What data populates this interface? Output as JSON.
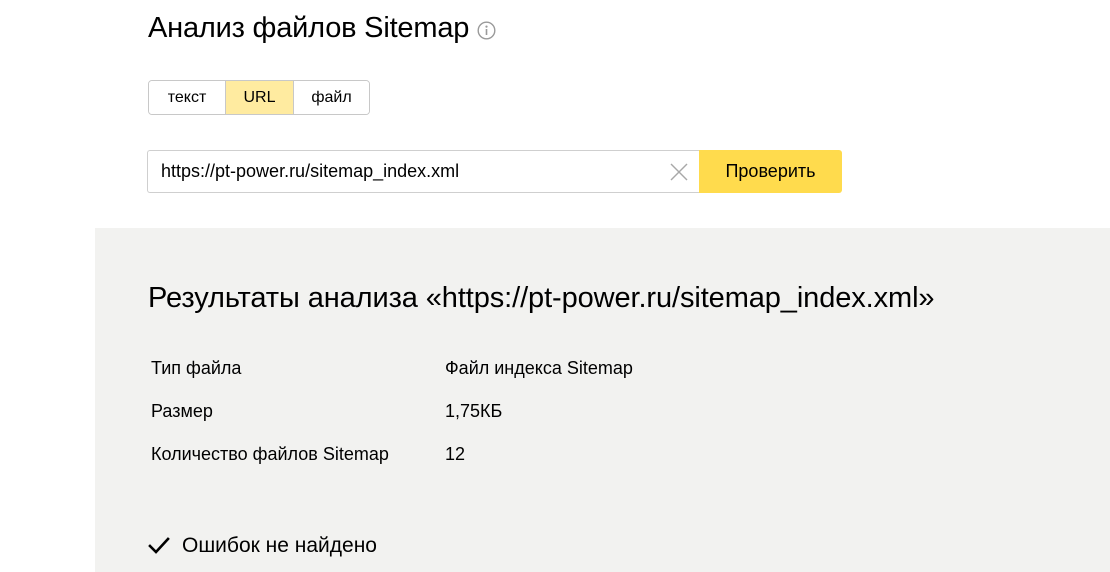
{
  "header": {
    "title": "Анализ файлов Sitemap",
    "info_icon": "info-icon"
  },
  "mode_switch": {
    "options": [
      "текст",
      "URL",
      "файл"
    ],
    "selected": "URL"
  },
  "url_form": {
    "input_value": "https://pt-power.ru/sitemap_index.xml",
    "clear_icon": "close-icon",
    "submit_label": "Проверить"
  },
  "results": {
    "title": "Результаты анализа «https://pt-power.ru/sitemap_index.xml»",
    "rows": [
      {
        "key": "Тип файла",
        "value": "Файл индекса Sitemap"
      },
      {
        "key": "Размер",
        "value": "1,75КБ"
      },
      {
        "key": "Количество файлов Sitemap",
        "value": "12"
      }
    ],
    "status_icon": "checkmark-icon",
    "status_text": "Ошибок не найдено"
  },
  "colors": {
    "accent_yellow": "#ffdb4d",
    "selected_tab": "#ffeba0",
    "panel_background": "#f2f2f0"
  }
}
